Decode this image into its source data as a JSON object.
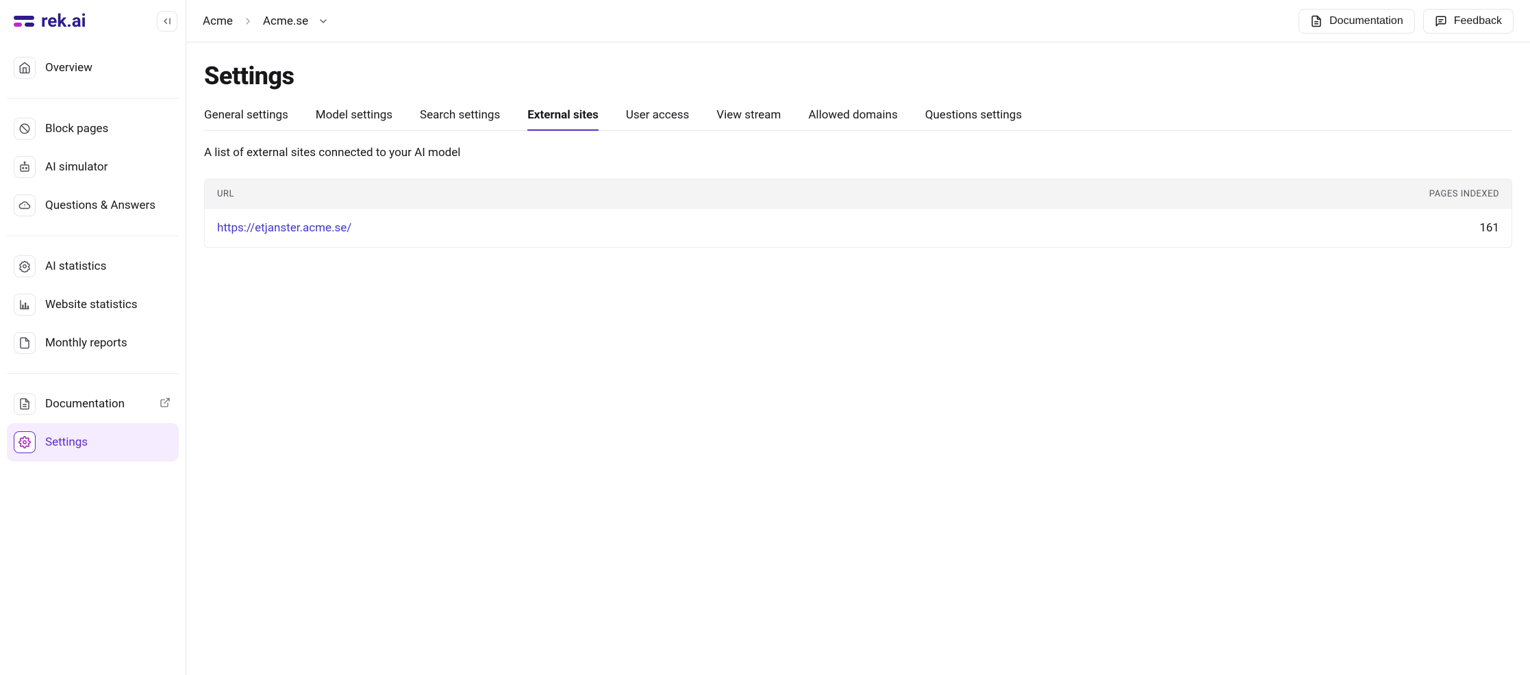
{
  "logo_text": "rek.ai",
  "sidebar": {
    "groups": [
      {
        "items": [
          {
            "id": "overview",
            "label": "Overview",
            "icon": "home"
          }
        ]
      },
      {
        "items": [
          {
            "id": "block-pages",
            "label": "Block pages",
            "icon": "block"
          },
          {
            "id": "ai-simulator",
            "label": "AI simulator",
            "icon": "robot"
          },
          {
            "id": "qa",
            "label": "Questions & Answers",
            "icon": "cloud-question"
          }
        ]
      },
      {
        "items": [
          {
            "id": "ai-statistics",
            "label": "AI statistics",
            "icon": "cog-badge"
          },
          {
            "id": "website-statistics",
            "label": "Website statistics",
            "icon": "bar-chart"
          },
          {
            "id": "monthly-reports",
            "label": "Monthly reports",
            "icon": "file"
          }
        ]
      },
      {
        "items": [
          {
            "id": "documentation",
            "label": "Documentation",
            "icon": "file-text",
            "ext": true
          },
          {
            "id": "settings",
            "label": "Settings",
            "icon": "gear",
            "active": true
          }
        ]
      }
    ]
  },
  "breadcrumb": {
    "org": "Acme",
    "site": "Acme.se"
  },
  "topbar": {
    "documentation": "Documentation",
    "feedback": "Feedback"
  },
  "page": {
    "title": "Settings",
    "tabs": [
      {
        "id": "general",
        "label": "General settings"
      },
      {
        "id": "model",
        "label": "Model settings"
      },
      {
        "id": "search",
        "label": "Search settings"
      },
      {
        "id": "external",
        "label": "External sites",
        "active": true
      },
      {
        "id": "user",
        "label": "User access"
      },
      {
        "id": "view",
        "label": "View stream"
      },
      {
        "id": "allowed",
        "label": "Allowed domains"
      },
      {
        "id": "questions",
        "label": "Questions settings"
      }
    ],
    "tab_description": "A list of external sites connected to your AI model",
    "table": {
      "columns": {
        "url": "URL",
        "pages": "PAGES INDEXED"
      },
      "rows": [
        {
          "url": "https://etjanster.acme.se/",
          "pages": "161"
        }
      ]
    }
  }
}
